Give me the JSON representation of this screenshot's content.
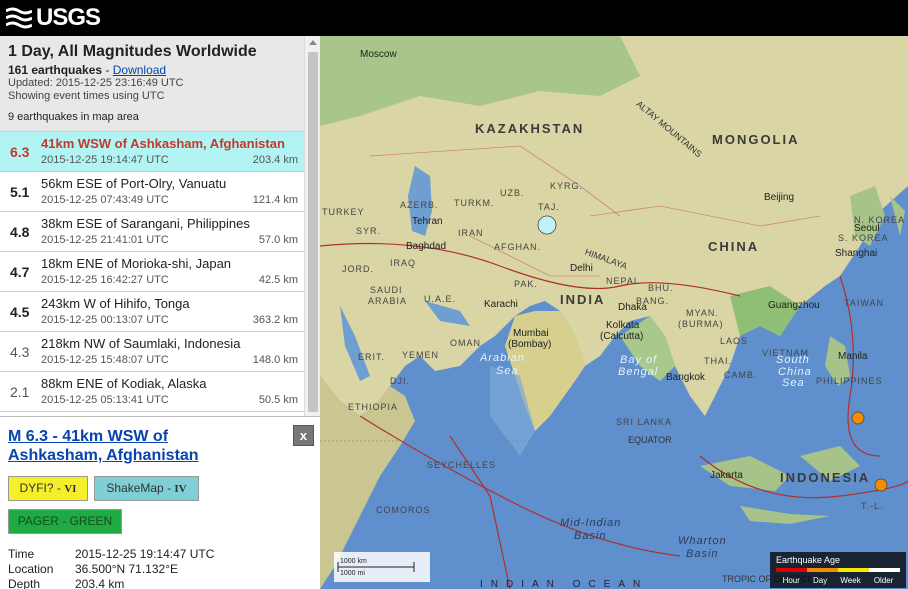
{
  "brand": {
    "logo_text": "USGS"
  },
  "summary": {
    "title": "1 Day, All Magnitudes Worldwide",
    "count_text": "161 earthquakes",
    "count_sep": " - ",
    "download_label": "Download",
    "updated": "Updated: 2015-12-25 23:16:49 UTC",
    "time_mode": "Showing event times using UTC",
    "in_area": "9 earthquakes in map area"
  },
  "earthquakes": [
    {
      "mag": "6.3",
      "place": "41km WSW of Ashkasham, Afghanistan",
      "time": "2015-12-25 19:14:47 UTC",
      "depth": "203.4 km"
    },
    {
      "mag": "5.1",
      "place": "56km ESE of Port-Olry, Vanuatu",
      "time": "2015-12-25 07:43:49 UTC",
      "depth": "121.4 km"
    },
    {
      "mag": "4.8",
      "place": "38km ESE of Sarangani, Philippines",
      "time": "2015-12-25 21:41:01 UTC",
      "depth": "57.0 km"
    },
    {
      "mag": "4.7",
      "place": "18km ENE of Morioka-shi, Japan",
      "time": "2015-12-25 16:42:27 UTC",
      "depth": "42.5 km"
    },
    {
      "mag": "4.5",
      "place": "243km W of Hihifo, Tonga",
      "time": "2015-12-25 00:13:07 UTC",
      "depth": "363.2 km"
    },
    {
      "mag": "4.3",
      "place": "218km NW of Saumlaki, Indonesia",
      "time": "2015-12-25 15:48:07 UTC",
      "depth": "148.0 km"
    },
    {
      "mag": "2.1",
      "place": "88km ENE of Kodiak, Alaska",
      "time": "2015-12-25 05:13:41 UTC",
      "depth": "50.5 km"
    }
  ],
  "detail": {
    "title": "M 6.3 - 41km WSW of Ashkasham, Afghanistan",
    "close_label": "x",
    "dyfi_label": "DYFI? - ",
    "dyfi_value": "VI",
    "shakemap_label": "ShakeMap - ",
    "shakemap_value": "IV",
    "pager_label": "PAGER - GREEN",
    "time_key": "Time",
    "time_val": "2015-12-25 19:14:47 UTC",
    "location_key": "Location",
    "location_val": "36.500°N 71.132°E",
    "depth_key": "Depth",
    "depth_val": "203.4 km"
  },
  "map": {
    "countries_large": [
      "KAZAKHSTAN",
      "MONGOLIA",
      "CHINA",
      "INDIA",
      "INDONESIA"
    ],
    "countries": [
      "TURKEY",
      "SYR.",
      "IRAQ",
      "IRAN",
      "AFGHAN.",
      "PAK.",
      "TURKM.",
      "UZB.",
      "KYRG.",
      "TAJ.",
      "AZERB.",
      "JORD.",
      "SAUDI",
      "ARABIA",
      "U.A.E.",
      "OMAN",
      "YEMEN",
      "ERIT.",
      "DJI.",
      "ETHIOPIA",
      "NEPAL",
      "BHU.",
      "BANG.",
      "(BURMA)",
      "MYAN.",
      "LAOS",
      "THAI.",
      "CAMB.",
      "VIETNAM",
      "PHILIPPINES",
      "S. KOREA",
      "N. KOREA",
      "SRI LANKA",
      "SEYCHELLES",
      "COMOROS",
      "T.-L.",
      "TAIWAN"
    ],
    "cities": [
      "Moscow",
      "Tehran",
      "Baghdad",
      "Beijing",
      "Seoul",
      "Shanghai",
      "Guangzhou",
      "Delhi",
      "Karachi",
      "Mumbai",
      "(Bombay)",
      "Kolkata",
      "(Calcutta)",
      "Dhaka",
      "Bangkok",
      "Manila",
      "Jakarta"
    ],
    "water": [
      "Arabian",
      "Sea",
      "Bay of",
      "Bengal",
      "South",
      "China",
      "Sea",
      "Mid-Indian",
      "Basin",
      "Wharton",
      "Basin",
      "EQUATOR",
      "ALTAY MOUNTAINS",
      "HIMALAYA",
      "TROPIC OF CAPRICORN",
      "INDIAN OCEAN"
    ],
    "scale_km": "1000 km",
    "scale_mi": "1000 mi"
  },
  "legend": {
    "title": "Earthquake Age",
    "labels": [
      "Hour",
      "Day",
      "Week",
      "Older"
    ],
    "colors": [
      "#e00000",
      "#f28c00",
      "#f7e600",
      "#ffffff"
    ]
  },
  "colors": {
    "selected_row": "#b2f4f4",
    "selected_text": "#c0392b",
    "dyfi": "#f5ef2a",
    "shakemap": "#7fd0d6",
    "pager": "#1faa45",
    "quake_selected": "#bff3f9",
    "quake_day": "#f28c00"
  }
}
